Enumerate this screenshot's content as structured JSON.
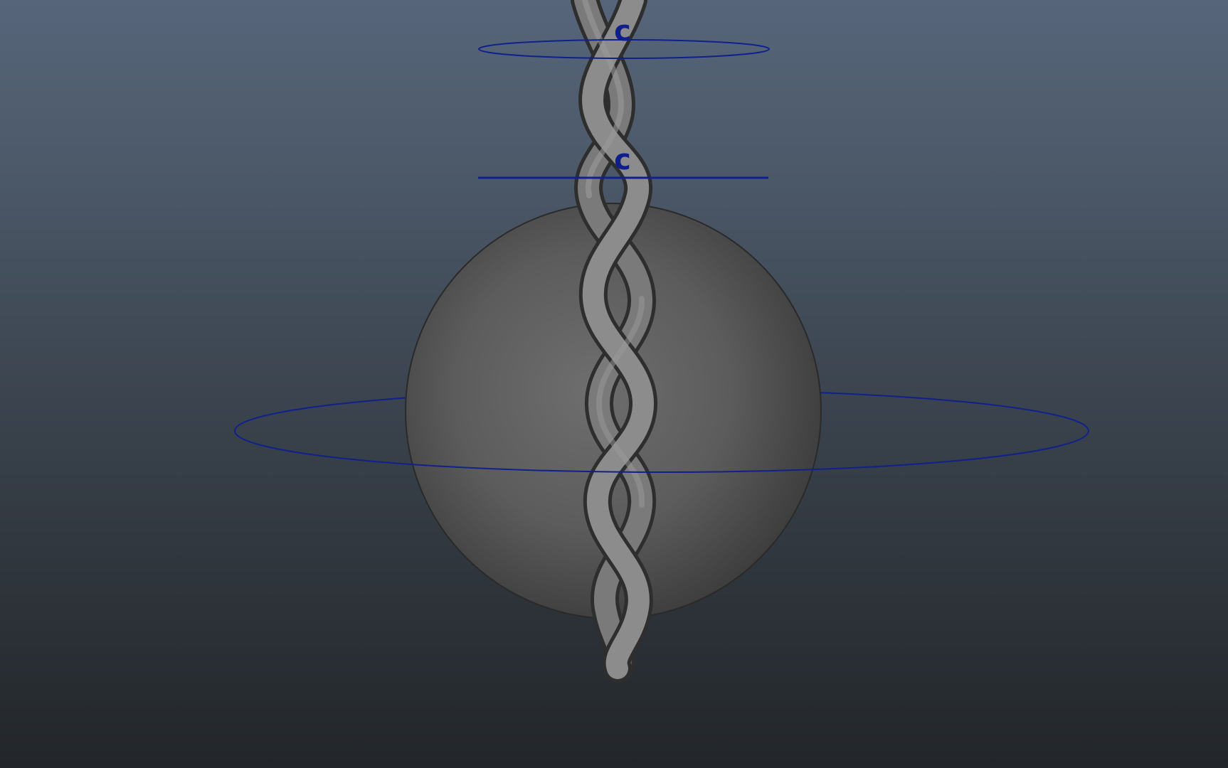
{
  "viewport": {
    "background_top": "#56657a",
    "background_bottom": "#22262a"
  },
  "scene": {
    "mesh_color": "#6b6b6b",
    "control_curve_color": "#10208c",
    "handles": [
      {
        "label": "c"
      },
      {
        "label": "c"
      }
    ]
  }
}
